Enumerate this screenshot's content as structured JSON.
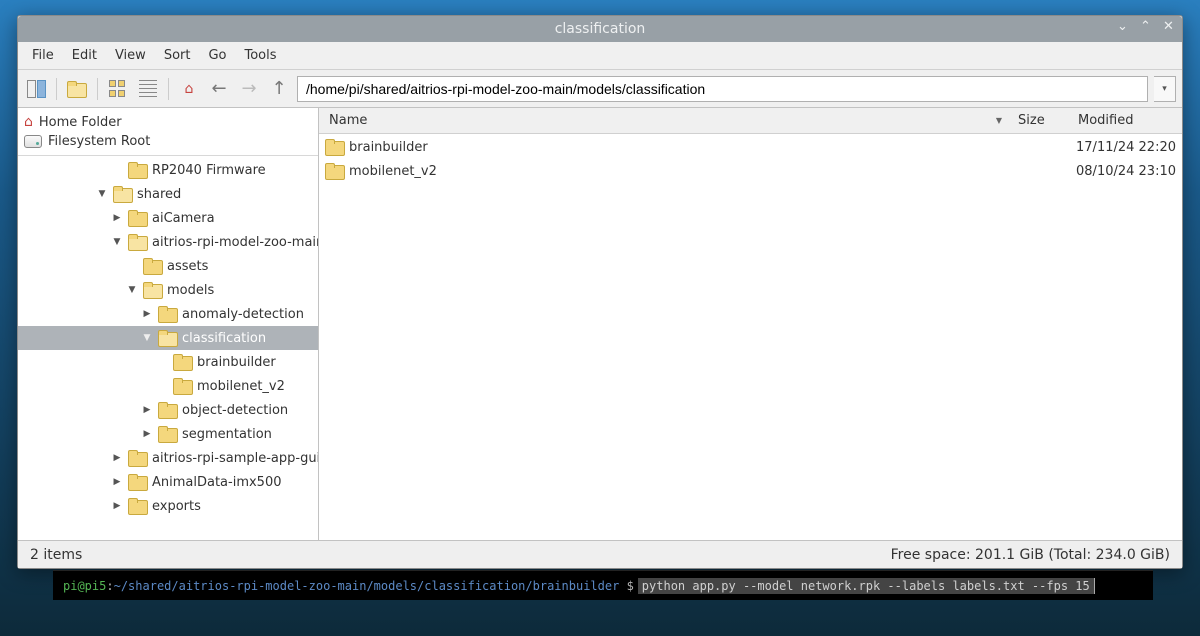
{
  "window": {
    "title": "classification"
  },
  "menubar": [
    "File",
    "Edit",
    "View",
    "Sort",
    "Go",
    "Tools"
  ],
  "toolbar": {
    "path": "/home/pi/shared/aitrios-rpi-model-zoo-main/models/classification"
  },
  "places": {
    "home": "Home Folder",
    "root": "Filesystem Root"
  },
  "tree": [
    {
      "level": 4,
      "expand": "",
      "label": "RP2040 Firmware"
    },
    {
      "level": 3,
      "expand": "open",
      "label": "shared"
    },
    {
      "level": 4,
      "expand": "closed",
      "label": "aiCamera"
    },
    {
      "level": 4,
      "expand": "open",
      "label": "aitrios-rpi-model-zoo-main"
    },
    {
      "level": 5,
      "expand": "",
      "label": "assets"
    },
    {
      "level": 5,
      "expand": "open",
      "label": "models"
    },
    {
      "level": 6,
      "expand": "closed",
      "label": "anomaly-detection"
    },
    {
      "level": 6,
      "expand": "open",
      "label": "classification",
      "selected": true
    },
    {
      "level": 7,
      "expand": "",
      "label": "brainbuilder"
    },
    {
      "level": 7,
      "expand": "",
      "label": "mobilenet_v2"
    },
    {
      "level": 6,
      "expand": "closed",
      "label": "object-detection"
    },
    {
      "level": 6,
      "expand": "closed",
      "label": "segmentation"
    },
    {
      "level": 4,
      "expand": "closed",
      "label": "aitrios-rpi-sample-app-gui-tool"
    },
    {
      "level": 4,
      "expand": "closed",
      "label": "AnimalData-imx500"
    },
    {
      "level": 4,
      "expand": "closed",
      "label": "exports"
    }
  ],
  "columns": {
    "name": "Name",
    "size": "Size",
    "modified": "Modified"
  },
  "files": [
    {
      "name": "brainbuilder",
      "size": "",
      "modified": "17/11/24 22:20"
    },
    {
      "name": "mobilenet_v2",
      "size": "",
      "modified": "08/10/24 23:10"
    }
  ],
  "statusbar": {
    "left": "2 items",
    "right": "Free space: 201.1 GiB (Total: 234.0 GiB)"
  },
  "terminal": {
    "user": "pi@pi5",
    "path": "~/shared/aitrios-rpi-model-zoo-main/models/classification/brainbuilder",
    "prompt": "$",
    "command": "python app.py --model network.rpk --labels labels.txt --fps 15"
  }
}
